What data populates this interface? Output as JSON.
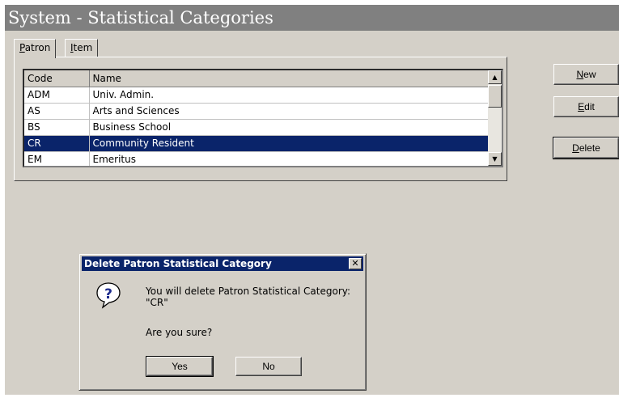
{
  "window": {
    "title": "System - Statistical Categories"
  },
  "tabs": [
    {
      "label": "Patron",
      "mnemonic": "P",
      "rest": "atron",
      "active": true
    },
    {
      "label": "Item",
      "mnemonic": "I",
      "rest": "tem",
      "active": false
    }
  ],
  "grid": {
    "columns": [
      "Code",
      "Name"
    ],
    "rows": [
      {
        "code": "ADM",
        "name": "Univ. Admin."
      },
      {
        "code": "AS",
        "name": "Arts and Sciences"
      },
      {
        "code": "BS",
        "name": "Business School"
      },
      {
        "code": "CR",
        "name": "Community Resident",
        "selected": true
      },
      {
        "code": "EM",
        "name": "Emeritus"
      }
    ]
  },
  "buttons": {
    "new": {
      "label": "New",
      "mnemonic": "N",
      "rest": "ew"
    },
    "edit": {
      "label": "Edit",
      "mnemonic": "E",
      "rest": "dit"
    },
    "delete": {
      "label": "Delete",
      "mnemonic": "D",
      "rest": "elete"
    }
  },
  "dialog": {
    "title": "Delete Patron Statistical Category",
    "icon": "question-icon",
    "message_line1": "You will delete Patron Statistical Category:",
    "message_line2": "\"CR\"",
    "question": "Are you sure?",
    "yes_label": "Yes",
    "no_label": "No"
  },
  "colors": {
    "title_bar": "#808080",
    "face": "#d4d0c8",
    "selection": "#0a246a"
  }
}
